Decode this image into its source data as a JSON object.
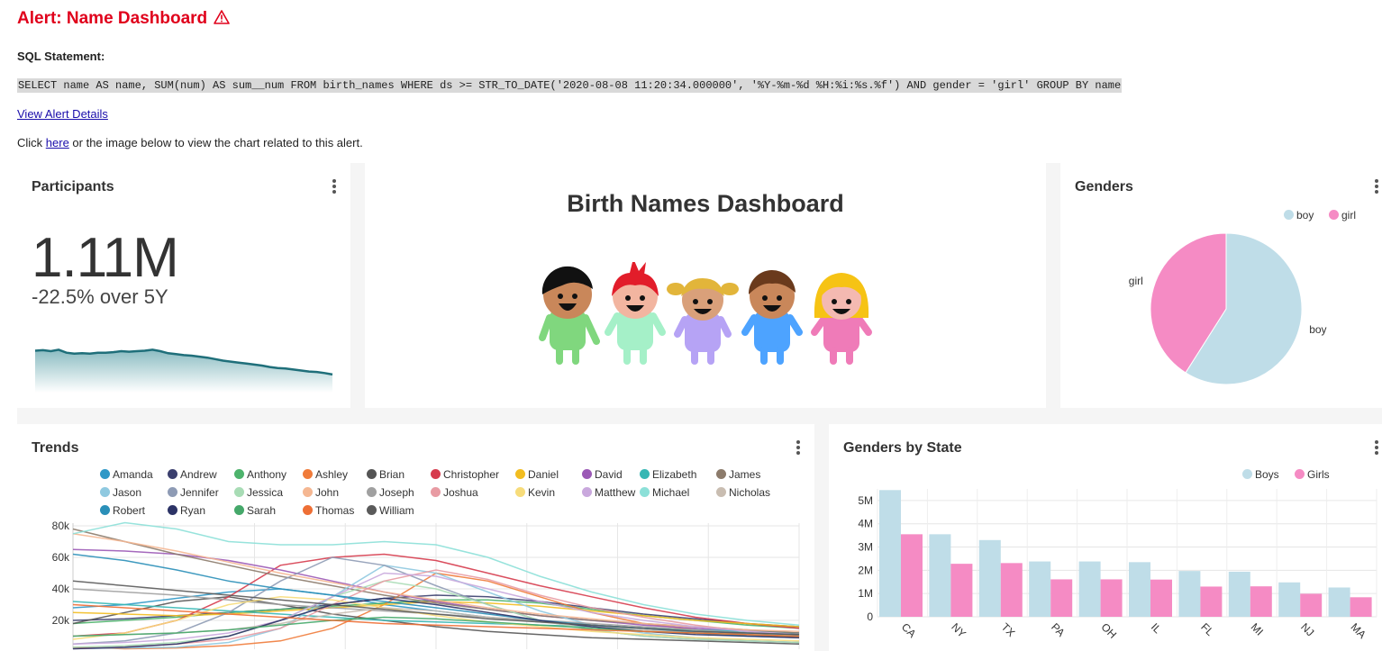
{
  "alert": {
    "title": "Alert: Name Dashboard",
    "icon": "warning-icon",
    "sql_label": "SQL Statement:",
    "sql": "SELECT name AS name, SUM(num) AS sum__num FROM birth_names WHERE ds >= STR_TO_DATE('2020-08-08 11:20:34.000000', '%Y-%m-%d %H:%i:%s.%f') AND gender = 'girl' GROUP BY name",
    "view_details": "View Alert Details",
    "click_prefix": "Click ",
    "click_link": "here",
    "click_suffix": " or the image below to view the chart related to this alert."
  },
  "cards": {
    "participants": {
      "title": "Participants",
      "value": "1.11M",
      "delta": "-22.5% over 5Y"
    },
    "birth_names": {
      "title": "Birth Names Dashboard"
    },
    "genders": {
      "title": "Genders"
    },
    "trends": {
      "title": "Trends"
    },
    "genders_by_state": {
      "title": "Genders by State"
    }
  },
  "colors": {
    "alert_red": "#e0001b",
    "link": "#1a0dab",
    "boy": "#bfdde8",
    "girl": "#f58bc4",
    "sparkline": "#1f6f7a"
  },
  "chart_data": [
    {
      "type": "area",
      "chart": "participants-sparkline",
      "values": [
        70,
        71,
        69,
        72,
        66,
        64,
        65,
        64,
        66,
        66,
        67,
        69,
        68,
        69,
        70,
        72,
        69,
        65,
        63,
        61,
        60,
        58,
        56,
        53,
        50,
        48,
        46,
        44,
        42,
        40,
        37,
        35,
        34,
        32,
        30,
        28,
        27,
        25,
        22
      ]
    },
    {
      "type": "pie",
      "chart": "genders",
      "legend": [
        "boy",
        "girl"
      ],
      "labels": [
        "boy",
        "girl"
      ],
      "values": [
        59,
        41
      ],
      "colors": [
        "#bfdde8",
        "#f58bc4"
      ]
    },
    {
      "type": "line",
      "chart": "trends",
      "legend_position": "top",
      "y_ticks": [
        "80k",
        "60k",
        "40k",
        "20k"
      ],
      "ylim": [
        0,
        80000
      ],
      "series": [
        {
          "name": "Amanda",
          "color": "#2f98c7",
          "values": [
            28000,
            30000,
            34000,
            38000,
            40000,
            36000,
            30000,
            26000,
            22000,
            19000,
            17000,
            15000,
            12000,
            10000,
            9000
          ]
        },
        {
          "name": "Andrew",
          "color": "#3b3f6e",
          "values": [
            20000,
            21000,
            23000,
            25000,
            27000,
            30000,
            34000,
            36000,
            35000,
            32000,
            28000,
            24000,
            21000,
            18000,
            16000
          ]
        },
        {
          "name": "Anthony",
          "color": "#4db36c",
          "values": [
            18000,
            20000,
            22000,
            25000,
            27000,
            29000,
            31000,
            33000,
            33000,
            31000,
            27000,
            23000,
            20000,
            17000,
            15000
          ]
        },
        {
          "name": "Ashley",
          "color": "#f07b3a",
          "values": [
            3000,
            2000,
            2500,
            4000,
            7000,
            15000,
            30000,
            50000,
            45000,
            35000,
            25000,
            18000,
            14000,
            11000,
            9000
          ]
        },
        {
          "name": "Brian",
          "color": "#555555",
          "values": [
            18000,
            25000,
            32000,
            35000,
            30000,
            24000,
            20000,
            16000,
            13000,
            11000,
            9000,
            8000,
            7000,
            6000,
            5000
          ]
        },
        {
          "name": "Christopher",
          "color": "#d63b4d",
          "values": [
            10000,
            12000,
            20000,
            35000,
            55000,
            60000,
            62000,
            58000,
            50000,
            42000,
            35000,
            28000,
            22000,
            18000,
            15000
          ]
        },
        {
          "name": "Daniel",
          "color": "#f2bd20",
          "values": [
            25000,
            24000,
            23000,
            24000,
            26000,
            28000,
            30000,
            32000,
            31000,
            29000,
            26000,
            23000,
            20000,
            18000,
            16000
          ]
        },
        {
          "name": "David",
          "color": "#9b59b6",
          "values": [
            65000,
            64000,
            62000,
            58000,
            52000,
            45000,
            38000,
            32000,
            27000,
            23000,
            20000,
            17000,
            15000,
            13000,
            12000
          ]
        },
        {
          "name": "Elizabeth",
          "color": "#36b7b4",
          "values": [
            32000,
            30000,
            28000,
            26000,
            24000,
            22000,
            20000,
            19000,
            18000,
            17000,
            16000,
            15000,
            14000,
            13000,
            12000
          ]
        },
        {
          "name": "James",
          "color": "#8c7b6b",
          "values": [
            78000,
            70000,
            62000,
            55000,
            48000,
            42000,
            36000,
            31000,
            27000,
            23000,
            20000,
            18000,
            16000,
            14000,
            12000
          ]
        },
        {
          "name": "Jason",
          "color": "#8fc9e0",
          "values": [
            2000,
            2500,
            3000,
            6000,
            15000,
            35000,
            55000,
            50000,
            38000,
            26000,
            17000,
            12000,
            9000,
            7000,
            6000
          ]
        },
        {
          "name": "Jennifer",
          "color": "#8e9bb5",
          "values": [
            5000,
            7000,
            12000,
            25000,
            45000,
            60000,
            55000,
            42000,
            30000,
            20000,
            14000,
            10000,
            8000,
            7000,
            6000
          ]
        },
        {
          "name": "Jessica",
          "color": "#a8dcb5",
          "values": [
            3000,
            4000,
            6000,
            10000,
            20000,
            35000,
            45000,
            40000,
            30000,
            20000,
            14000,
            10000,
            8000,
            7000,
            6000
          ]
        },
        {
          "name": "John",
          "color": "#f5b792",
          "values": [
            75000,
            70000,
            64000,
            57000,
            50000,
            44000,
            38000,
            33000,
            28000,
            24000,
            21000,
            18000,
            16000,
            14000,
            13000
          ]
        },
        {
          "name": "Joseph",
          "color": "#a0a0a0",
          "values": [
            40000,
            38000,
            36000,
            33000,
            30000,
            28000,
            26000,
            24000,
            22000,
            20000,
            18000,
            16000,
            14000,
            12000,
            11000
          ]
        },
        {
          "name": "Joshua",
          "color": "#e89ba3",
          "values": [
            2000,
            3000,
            5000,
            8000,
            15000,
            30000,
            45000,
            52000,
            46000,
            36000,
            28000,
            22000,
            17000,
            13000,
            11000
          ]
        },
        {
          "name": "Kevin",
          "color": "#f7dc7a",
          "values": [
            8000,
            12000,
            20000,
            30000,
            35000,
            33000,
            28000,
            23000,
            19000,
            16000,
            13000,
            11000,
            9000,
            8000,
            7000
          ]
        },
        {
          "name": "Matthew",
          "color": "#c9a8dd",
          "values": [
            5000,
            6000,
            8000,
            12000,
            20000,
            35000,
            50000,
            48000,
            40000,
            32000,
            25000,
            20000,
            16000,
            13000,
            11000
          ]
        },
        {
          "name": "Michael",
          "color": "#8ce0d8",
          "values": [
            75000,
            82000,
            78000,
            70000,
            68000,
            68000,
            70000,
            68000,
            60000,
            48000,
            38000,
            30000,
            24000,
            20000,
            17000
          ]
        },
        {
          "name": "Nicholas",
          "color": "#c9bdb1",
          "values": [
            10000,
            11000,
            12000,
            14000,
            18000,
            24000,
            28000,
            26000,
            22000,
            19000,
            16000,
            14000,
            12000,
            11000,
            10000
          ]
        },
        {
          "name": "Robert",
          "color": "#2a8fb8",
          "values": [
            62000,
            58000,
            52000,
            45000,
            40000,
            36000,
            32000,
            28000,
            24000,
            20000,
            17000,
            15000,
            13000,
            12000,
            11000
          ]
        },
        {
          "name": "Ryan",
          "color": "#2c3366",
          "values": [
            2000,
            3000,
            5000,
            10000,
            20000,
            30000,
            34000,
            30000,
            25000,
            20000,
            16000,
            13000,
            11000,
            10000,
            9000
          ]
        },
        {
          "name": "Sarah",
          "color": "#45a86a",
          "values": [
            10000,
            11000,
            12000,
            14000,
            17000,
            20000,
            22000,
            21000,
            19000,
            17000,
            15000,
            13000,
            12000,
            11000,
            10000
          ]
        },
        {
          "name": "Thomas",
          "color": "#ee6f35",
          "values": [
            30000,
            28000,
            26000,
            24000,
            22000,
            20000,
            18000,
            17000,
            16000,
            15000,
            14000,
            13000,
            12000,
            11000,
            10000
          ]
        },
        {
          "name": "William",
          "color": "#5a5a5a",
          "values": [
            45000,
            42000,
            39000,
            36000,
            33000,
            30000,
            27000,
            24000,
            21000,
            19000,
            17000,
            15000,
            13000,
            12000,
            11000
          ]
        }
      ]
    },
    {
      "type": "bar",
      "chart": "genders-by-state",
      "categories": [
        "CA",
        "NY",
        "TX",
        "PA",
        "OH",
        "IL",
        "FL",
        "MI",
        "NJ",
        "MA"
      ],
      "series": [
        {
          "name": "Boys",
          "color": "#bfdde8",
          "values": [
            5450000,
            3550000,
            3300000,
            2380000,
            2380000,
            2350000,
            1970000,
            1940000,
            1480000,
            1260000
          ]
        },
        {
          "name": "Girls",
          "color": "#f58bc4",
          "values": [
            3550000,
            2280000,
            2310000,
            1610000,
            1610000,
            1600000,
            1300000,
            1310000,
            990000,
            840000
          ]
        }
      ],
      "y_ticks": [
        "5M",
        "4M",
        "3M",
        "2M",
        "1M",
        "0"
      ],
      "ylim": [
        0,
        5500000
      ]
    }
  ]
}
